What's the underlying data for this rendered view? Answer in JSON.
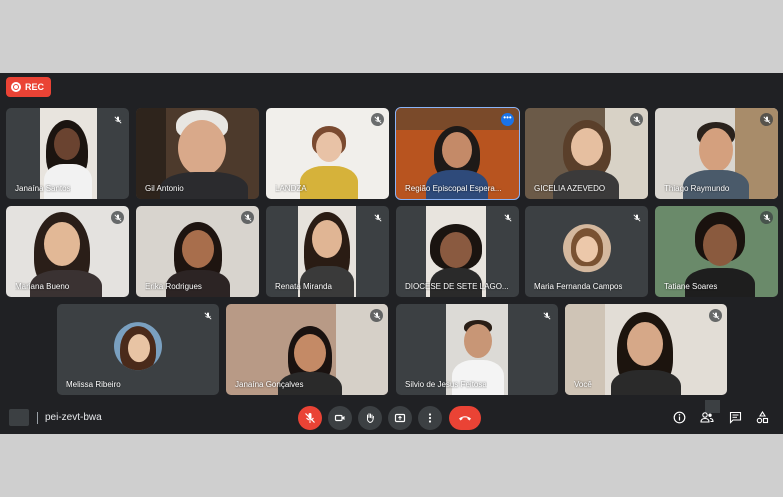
{
  "recording": {
    "label": "REC"
  },
  "meeting": {
    "code": "pei-zevt-bwa"
  },
  "participants": [
    {
      "name": "Janaína Santos"
    },
    {
      "name": "Gil Antonio"
    },
    {
      "name": "LANDZA"
    },
    {
      "name": "Região Episcopal Espera..."
    },
    {
      "name": "GICELIA AZEVEDO"
    },
    {
      "name": "Thiago Raymundo"
    },
    {
      "name": "Mariana Bueno"
    },
    {
      "name": "Erika Rodrigues"
    },
    {
      "name": "Renata Miranda"
    },
    {
      "name": "DIOCESE DE SETE LAGO..."
    },
    {
      "name": "Maria Fernanda Campos"
    },
    {
      "name": "Tatiane Soares"
    },
    {
      "name": "Melissa Ribeiro"
    },
    {
      "name": "Janaína Gonçalves"
    },
    {
      "name": "Silvio de Jesus Feitosa"
    },
    {
      "name": "Você"
    }
  ],
  "controls": [
    "mic-off-icon",
    "camera-icon",
    "raise-hand-icon",
    "present-icon",
    "more-icon",
    "hang-up-icon"
  ],
  "right_controls": [
    "info-icon",
    "people-icon",
    "chat-icon",
    "activities-icon"
  ],
  "colors": {
    "background": "#202124",
    "tile": "#3c4043",
    "accent_red": "#ea4335",
    "active_outline": "#8ab4f8"
  }
}
